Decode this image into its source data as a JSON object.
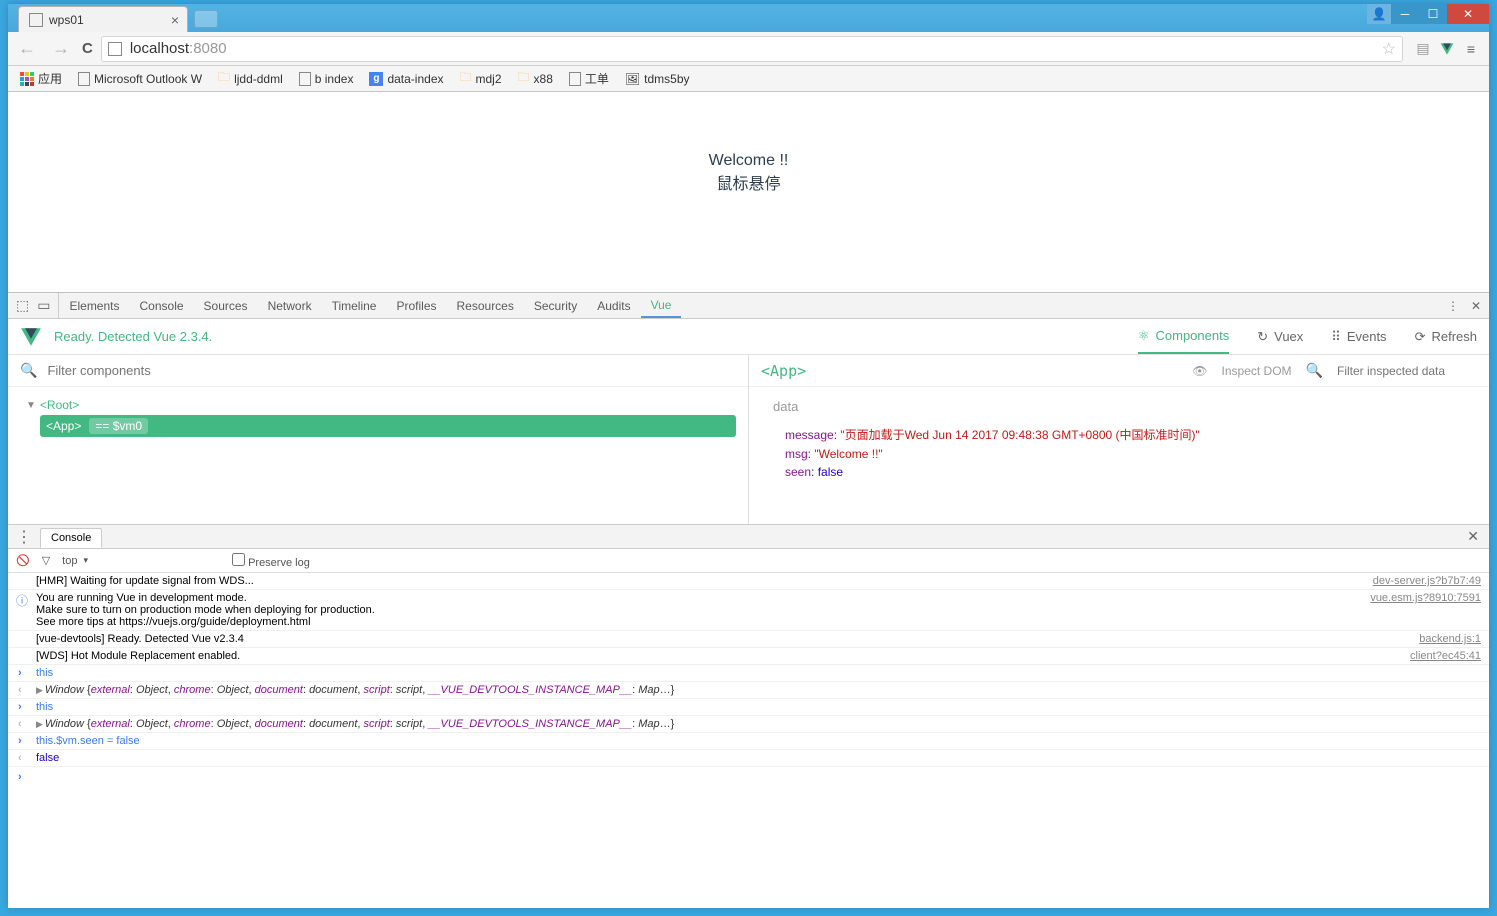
{
  "browser": {
    "tab_title": "wps01",
    "url_host": "localhost",
    "url_port": ":8080"
  },
  "bookmarks": {
    "apps": "应用",
    "items": [
      {
        "label": "Microsoft Outlook W",
        "type": "page"
      },
      {
        "label": "ljdd-ddml",
        "type": "folder"
      },
      {
        "label": "b index",
        "type": "page"
      },
      {
        "label": "data-index",
        "type": "google"
      },
      {
        "label": "mdj2",
        "type": "folder"
      },
      {
        "label": "x88",
        "type": "folder"
      },
      {
        "label": "工单",
        "type": "page"
      },
      {
        "label": "tdms5by",
        "type": "img"
      }
    ]
  },
  "page": {
    "welcome": "Welcome !!",
    "hover": "鼠标悬停"
  },
  "devtools": {
    "tabs": [
      "Elements",
      "Console",
      "Sources",
      "Network",
      "Timeline",
      "Profiles",
      "Resources",
      "Security",
      "Audits",
      "Vue"
    ],
    "vue_status": "Ready. Detected Vue 2.3.4.",
    "vue_tabs": {
      "components": "Components",
      "vuex": "Vuex",
      "events": "Events",
      "refresh": "Refresh"
    },
    "filter_placeholder": "Filter components",
    "tree": {
      "root": "<Root>",
      "app": "<App>",
      "vm": "== $vm0"
    },
    "detail": {
      "name": "<App>",
      "inspect_dom": "Inspect DOM",
      "filter_placeholder": "Filter inspected data",
      "section": "data",
      "rows": [
        {
          "key": "message",
          "val": "\"页面加载于Wed Jun 14 2017 09:48:38 GMT+0800 (中国标准时间)\"",
          "type": "str"
        },
        {
          "key": "msg",
          "val": "\"Welcome !!\"",
          "type": "str"
        },
        {
          "key": "seen",
          "val": "false",
          "type": "bool"
        }
      ]
    }
  },
  "console": {
    "drawer_tab": "Console",
    "context": "top",
    "preserve": "Preserve log",
    "lines": [
      {
        "kind": "log",
        "msg": "[HMR] Waiting for update signal from WDS...",
        "src": "dev-server.js?b7b7:49"
      },
      {
        "kind": "info",
        "msg": "You are running Vue in development mode.\nMake sure to turn on production mode when deploying for production.\nSee more tips at https://vuejs.org/guide/deployment.html",
        "src": "vue.esm.js?8910:7591"
      },
      {
        "kind": "log",
        "msg": "[vue-devtools] Ready. Detected Vue v2.3.4",
        "src": "backend.js:1"
      },
      {
        "kind": "log",
        "msg": "[WDS] Hot Module Replacement enabled.",
        "src": "client?ec45:41"
      },
      {
        "kind": "input",
        "msg": "this"
      },
      {
        "kind": "output-obj"
      },
      {
        "kind": "input",
        "msg": "this"
      },
      {
        "kind": "output-obj"
      },
      {
        "kind": "input",
        "msg": "this.$vm.seen = false"
      },
      {
        "kind": "output-bool",
        "msg": "false"
      }
    ],
    "window_preview": {
      "cls": "Window",
      "props": [
        {
          "k": "external",
          "v": "Object",
          "o": true
        },
        {
          "k": "chrome",
          "v": "Object",
          "o": true
        },
        {
          "k": "document",
          "v": "document",
          "o": true
        },
        {
          "k": "script",
          "v": "script",
          "o": true
        },
        {
          "k": "__VUE_DEVTOOLS_INSTANCE_MAP__",
          "v": "Map",
          "o": true
        }
      ]
    }
  }
}
